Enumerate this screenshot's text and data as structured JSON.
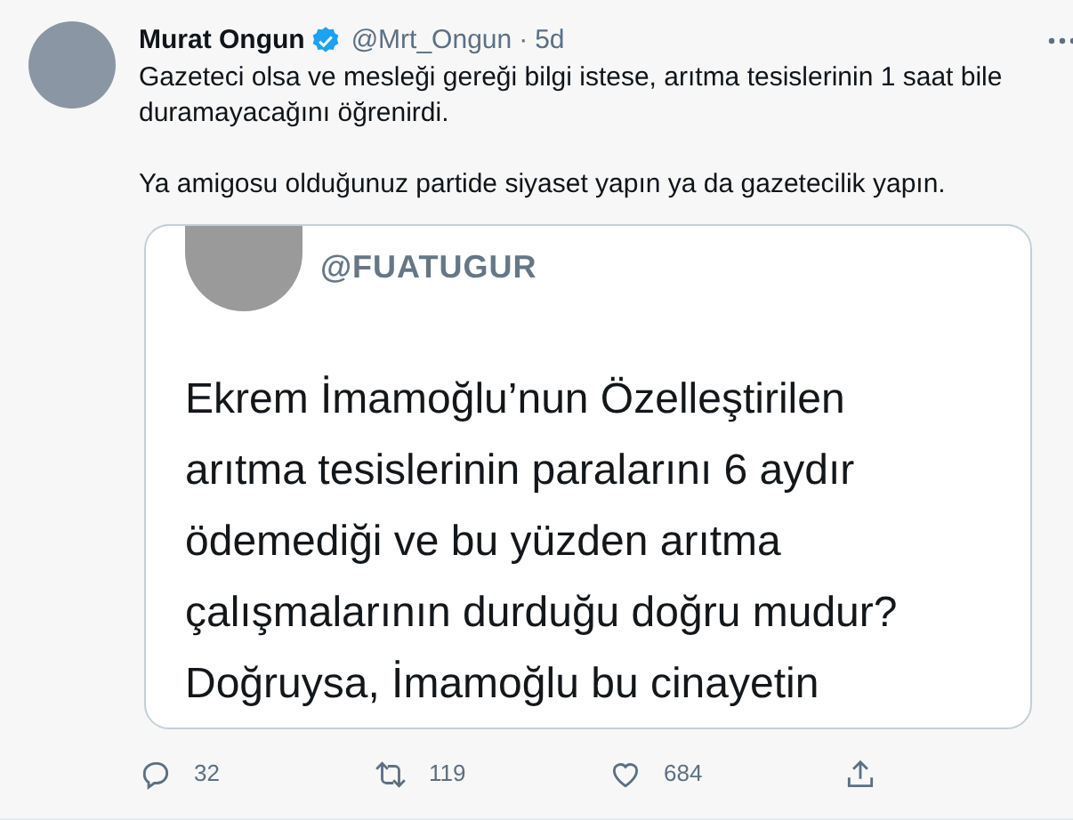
{
  "tweet": {
    "name": "Murat Ongun",
    "verified": true,
    "handle": "@Mrt_Ongun",
    "separator": "·",
    "time": "5d",
    "paragraphs": [
      "Gazeteci olsa ve mesleği gereği bilgi istese, arıtma tesislerinin 1 saat bile duramayacağını öğrenirdi.",
      "Ya amigosu olduğunuz partide siyaset yapın ya da gazetecilik yapın."
    ]
  },
  "embedded_screenshot": {
    "handle": "@FUATUGUR",
    "lines": [
      "Ekrem İmamoğlu’nun Özelleştirilen",
      "arıtma tesislerinin paralarını 6 aydır",
      "ödemediği ve bu yüzden arıtma",
      "çalışmalarının durduğu doğru mudur?",
      "Doğruysa, İmamoğlu bu cinayetin"
    ]
  },
  "actions": [
    {
      "kind": "reply",
      "count": "32"
    },
    {
      "kind": "retweet",
      "count": "119"
    },
    {
      "kind": "like",
      "count": "684"
    },
    {
      "kind": "share"
    }
  ]
}
